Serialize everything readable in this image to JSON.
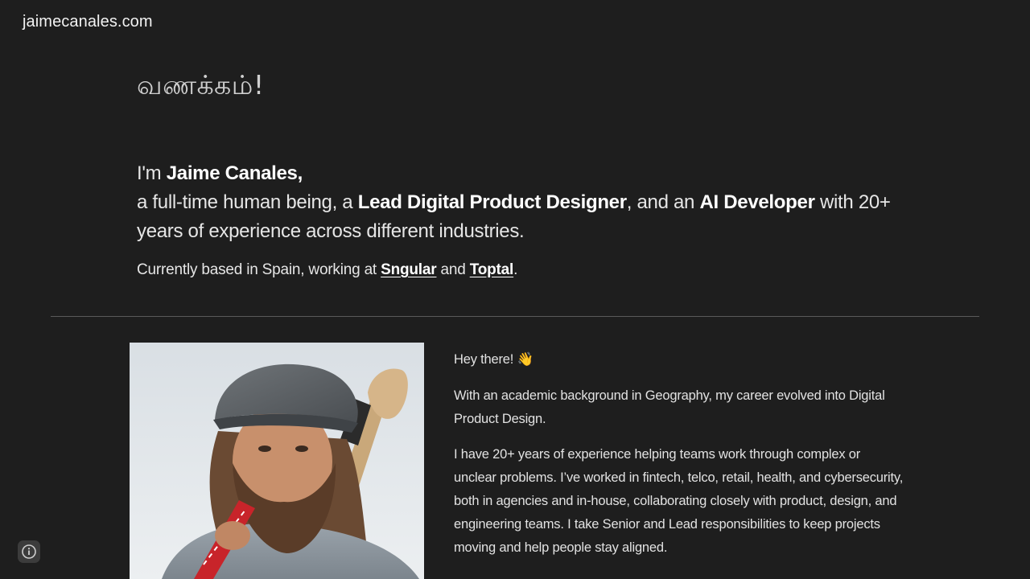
{
  "header": {
    "site_title": "jaimecanales.com"
  },
  "hero": {
    "greeting": "வணக்கம்!",
    "intro_prefix": "I'm ",
    "intro_name": "Jaime Canales",
    "intro_comma": ",",
    "intro_line2_a": "a full-time human being, a ",
    "intro_role1": "Lead Digital Product Designer",
    "intro_line2_b": ", and an ",
    "intro_role2": "AI Developer",
    "intro_line2_c": " with 20+ years of experience across different industries.",
    "location_prefix": "Currently based in Spain, working at ",
    "company1": "Sngular",
    "location_and": " and ",
    "company2": "Toptal",
    "location_suffix": "."
  },
  "about": {
    "portrait_alt": "Portrait of Jaime Canales",
    "hey": "Hey there! 👋",
    "para1": "With an academic background in Geography, my career evolved into Digital Product Design.",
    "para2": "I have 20+ years of experience helping teams work through complex or unclear problems. I’ve worked in fintech, telco, retail, health, and cybersecurity, both in agencies and in-house, collaborating closely with product, design, and engineering teams. I take Senior and Lead responsibilities to keep projects moving and help people stay aligned."
  },
  "footer": {
    "info_icon": "info-icon"
  }
}
